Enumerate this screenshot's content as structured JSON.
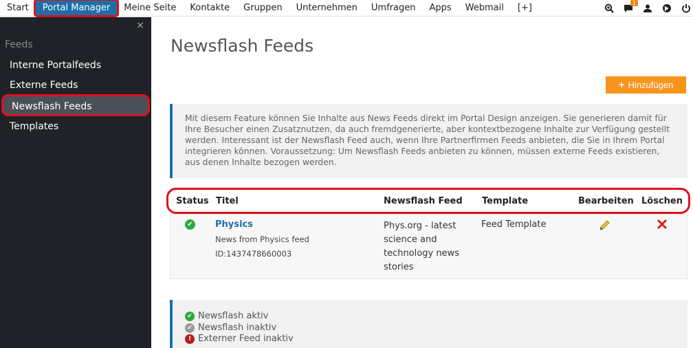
{
  "nav": {
    "items": [
      "Start",
      "Portal Manager",
      "Meine Seite",
      "Kontakte",
      "Gruppen",
      "Unternehmen",
      "Umfragen",
      "Apps",
      "Webmail",
      "[+]"
    ],
    "active_index": 1,
    "notification_count": "1",
    "icons": [
      "search-zoom-icon",
      "chat-icon",
      "user-icon",
      "globe-icon",
      "power-icon"
    ]
  },
  "sidebar": {
    "close": "×",
    "title": "Feeds",
    "items": [
      "Interne Portalfeeds",
      "Externe Feeds",
      "Newsflash Feeds",
      "Templates"
    ],
    "active_index": 2
  },
  "main": {
    "title": "Newsflash Feeds",
    "add_button": "Hinzufügen",
    "info_text": "Mit diesem Feature können Sie Inhalte aus News Feeds direkt im Portal Design anzeigen. Sie generieren damit für Ihre Besucher einen Zusatznutzen, da auch fremdgenerierte, aber kontextbezogene Inhalte zur Verfügung gestellt werden. Interessant ist der Newsflash Feed auch, wenn Ihre Partnerfirmen Feeds anbieten, die Sie in Ihrem Portal integrieren können. Voraussetzung: Um Newsflash Feeds anbieten zu können, müssen externe Feeds existieren, aus denen Inhalte bezogen werden."
  },
  "table": {
    "headers": {
      "status": "Status",
      "title": "Titel",
      "feed": "Newsflash Feed",
      "template": "Template",
      "edit": "Bearbeiten",
      "delete": "Löschen"
    },
    "rows": [
      {
        "status": "active",
        "title": "Physics",
        "description": "News from Physics feed",
        "id": "ID:1437478660003",
        "feed": "Phys.org - latest science and technology news stories",
        "template": "Feed Template"
      }
    ]
  },
  "legend": {
    "active": "Newsflash aktiv",
    "inactive": "Newsflash inaktiv",
    "external_inactive": "Externer Feed inaktiv"
  },
  "colors": {
    "accent": "#1e6fa8",
    "button": "#f7941d",
    "highlight": "#e0101e",
    "ok": "#2dab3c"
  }
}
